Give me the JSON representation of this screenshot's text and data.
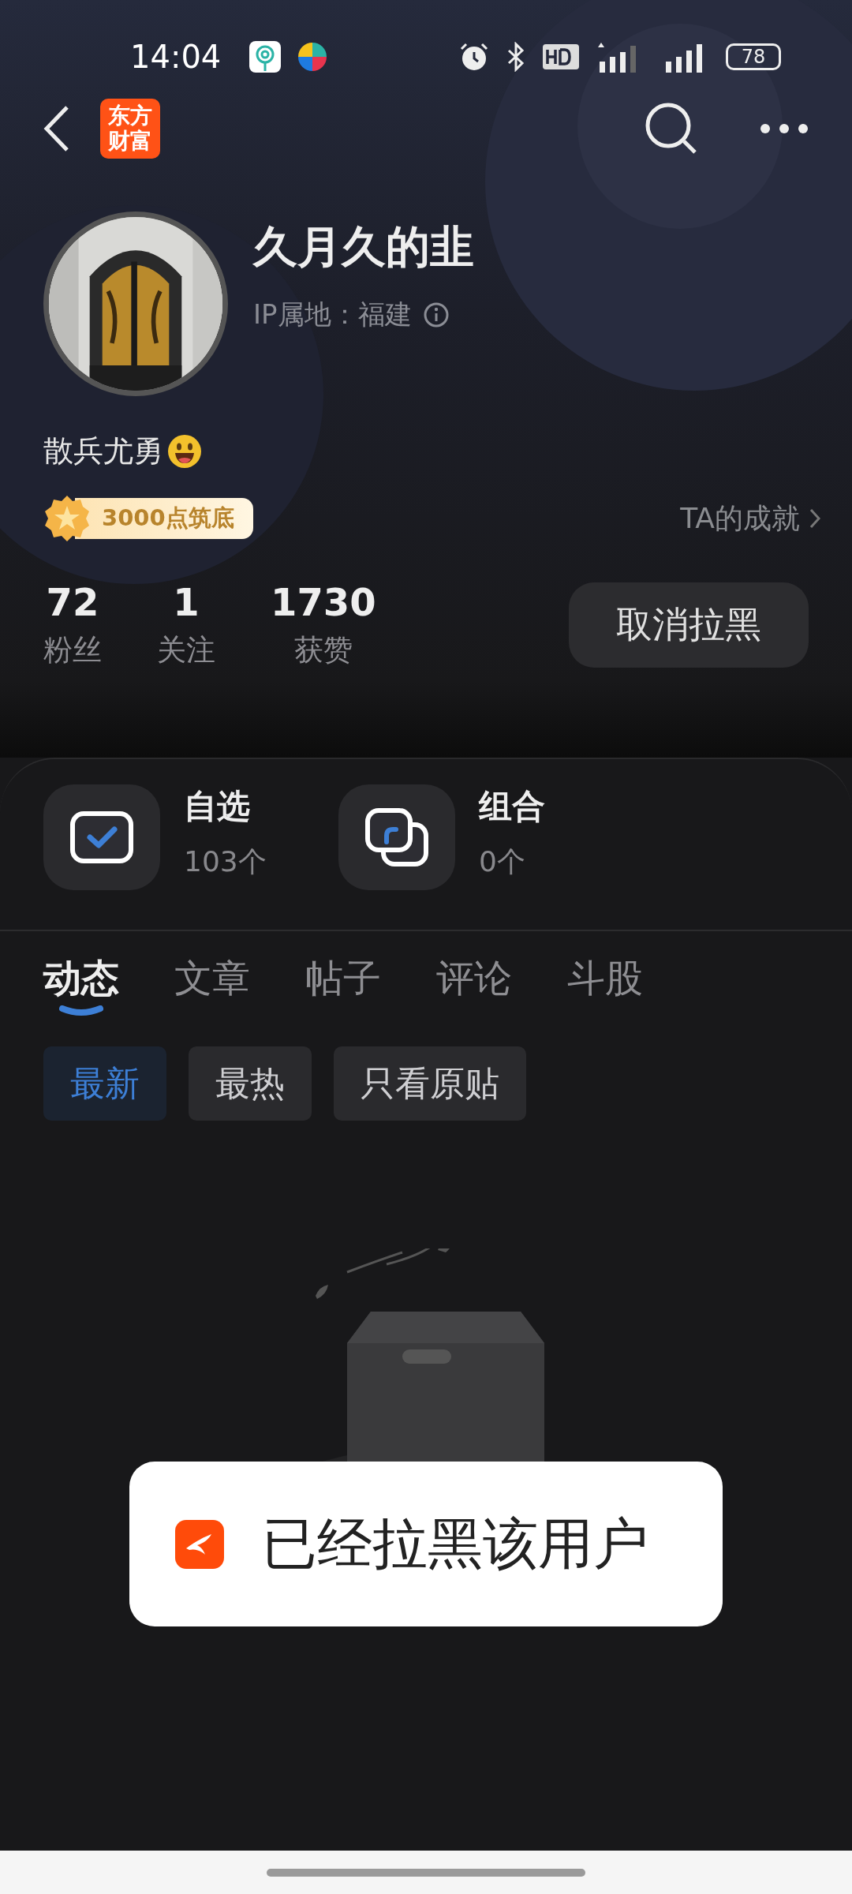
{
  "status_bar": {
    "time": "14:04",
    "battery": "78"
  },
  "header": {
    "logo_text": [
      "东方",
      "财富"
    ]
  },
  "profile": {
    "name": "久月久的韭",
    "ip_location": "IP属地：福建",
    "bio": "散兵尤勇",
    "badge": "3000点筑底",
    "achievements_link": "TA的成就"
  },
  "stats": [
    {
      "value": "72",
      "label": "粉丝"
    },
    {
      "value": "1",
      "label": "关注"
    },
    {
      "value": "1730",
      "label": "获赞"
    }
  ],
  "unblock_button": "取消拉黑",
  "collections": [
    {
      "kind": "watchlist",
      "title": "自选",
      "count": "103个"
    },
    {
      "kind": "portfolio",
      "title": "组合",
      "count": "0个"
    }
  ],
  "tabs": [
    {
      "label": "动态",
      "selected": true
    },
    {
      "label": "文章",
      "selected": false
    },
    {
      "label": "帖子",
      "selected": false
    },
    {
      "label": "评论",
      "selected": false
    },
    {
      "label": "斗股",
      "selected": false
    }
  ],
  "filters": [
    {
      "label": "最新",
      "selected": true
    },
    {
      "label": "最热",
      "selected": false
    },
    {
      "label": "只看原贴",
      "selected": false
    }
  ],
  "toast": {
    "text": "已经拉黑该用户"
  }
}
